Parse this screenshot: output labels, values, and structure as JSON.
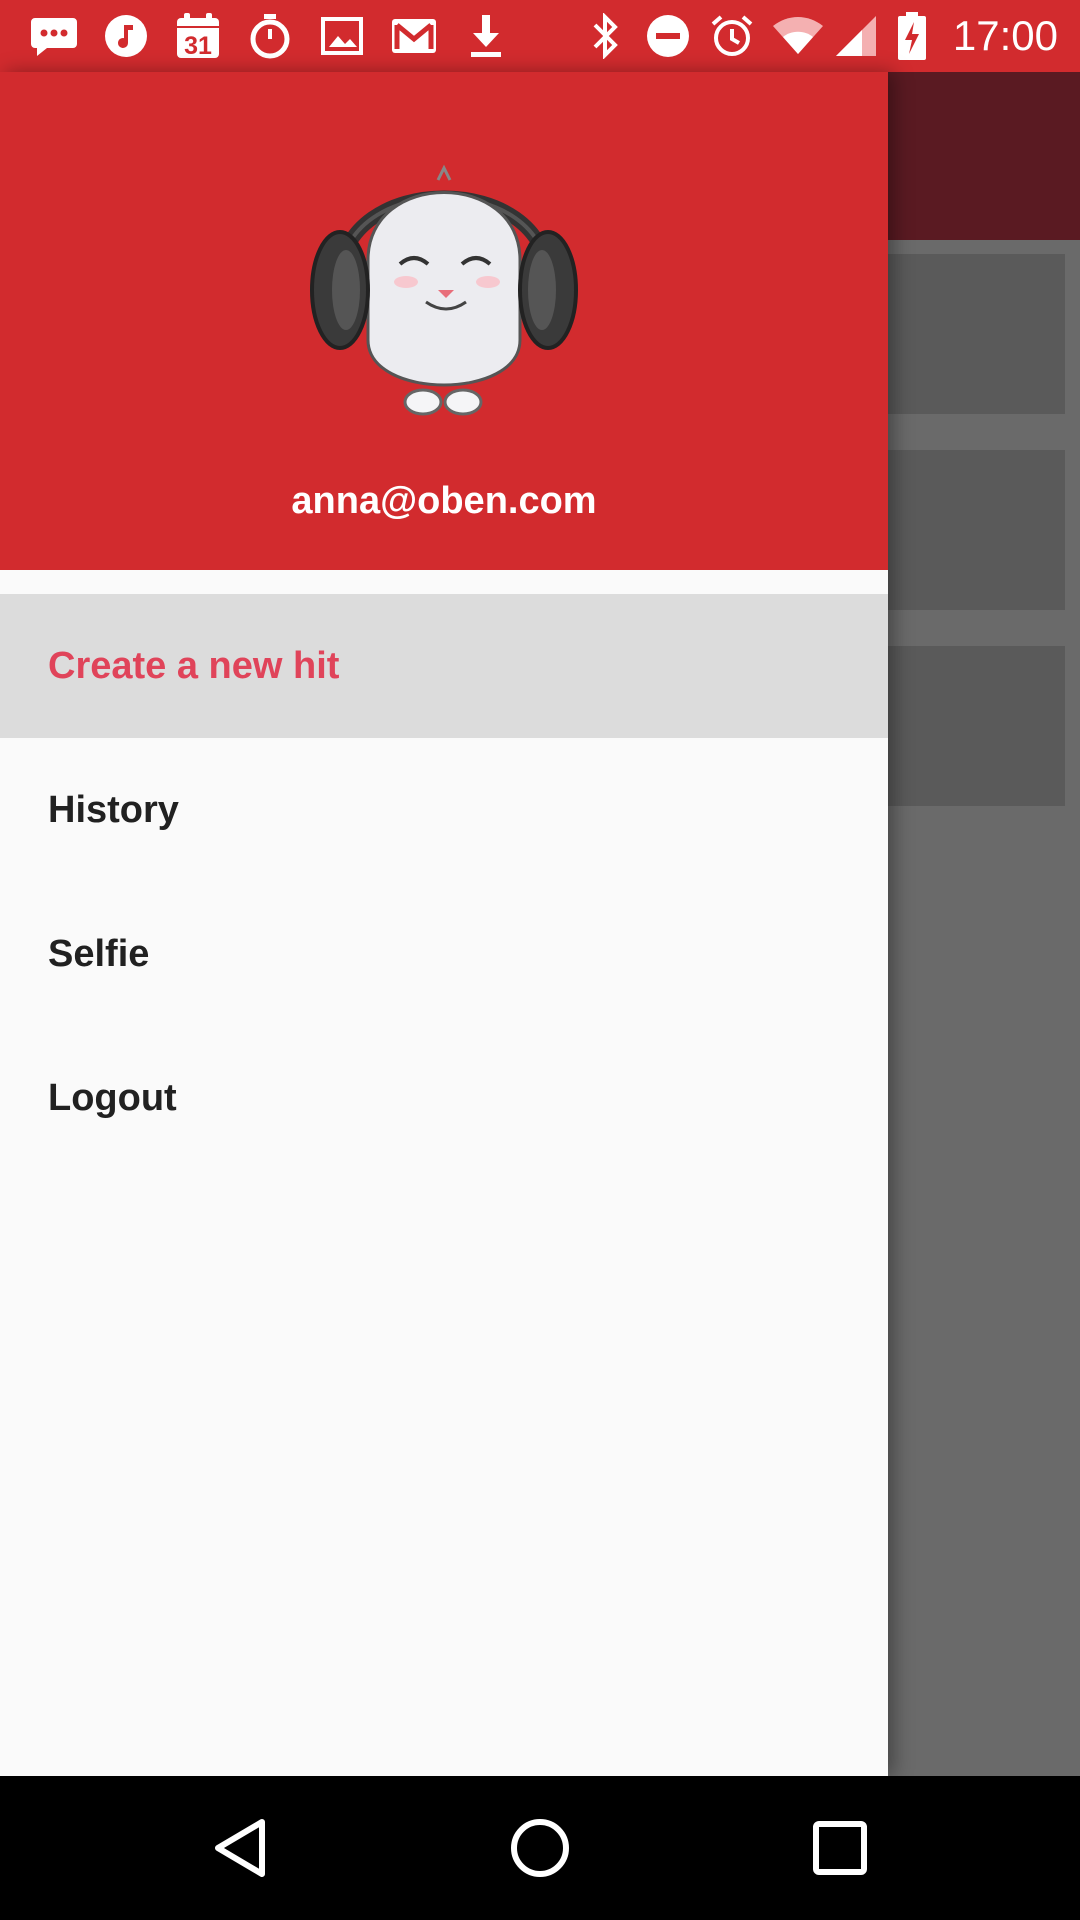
{
  "status_bar": {
    "time": "17:00",
    "calendar_day": "31",
    "left_icons": [
      "more-messages-icon",
      "music-icon",
      "calendar-icon",
      "stopwatch-icon",
      "gallery-icon",
      "gmail-icon",
      "download-icon"
    ],
    "right_icons": [
      "bluetooth-icon",
      "do-not-disturb-icon",
      "alarm-icon",
      "wifi-icon",
      "signal-icon",
      "battery-charging-icon"
    ]
  },
  "drawer": {
    "user_email": "anna@oben.com",
    "menu_items": [
      {
        "label": "Create a new hit",
        "active": true
      },
      {
        "label": "History",
        "active": false
      },
      {
        "label": "Selfie",
        "active": false
      },
      {
        "label": "Logout",
        "active": false
      }
    ]
  },
  "navigation_bar": {
    "buttons": [
      "back-icon",
      "home-icon",
      "recents-icon"
    ]
  },
  "colors": {
    "primary": "#d22b2e",
    "accent_text": "#e0445a",
    "active_item_bg": "#dcdcdc",
    "drawer_bg": "#fafafa"
  }
}
